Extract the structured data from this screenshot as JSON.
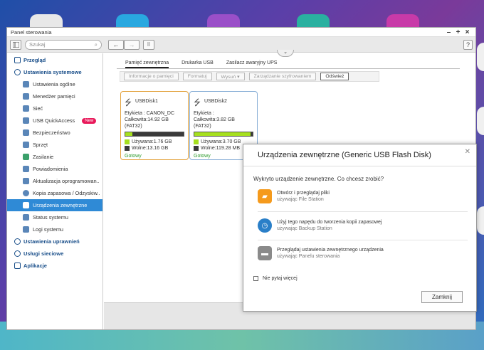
{
  "window": {
    "title": "Panel sterowania",
    "controls": [
      "–",
      "+",
      "×"
    ]
  },
  "toolbar": {
    "search_placeholder": "Szukaj",
    "back_icon": "arrow-left-icon",
    "forward_icon": "arrow-right-icon",
    "help_label": "?"
  },
  "sidebar": {
    "overview": "Przegląd",
    "system_settings": "Ustawienia systemowe",
    "items": [
      {
        "label": "Ustawienia ogólne"
      },
      {
        "label": "Menedżer pamięci"
      },
      {
        "label": "Sieć"
      },
      {
        "label": "USB QuickAccess",
        "badge": "New"
      },
      {
        "label": "Bezpieczeństwo"
      },
      {
        "label": "Sprzęt"
      },
      {
        "label": "Zasilanie"
      },
      {
        "label": "Powiadomienia"
      },
      {
        "label": "Aktualizacja oprogramowan.."
      },
      {
        "label": "Kopia zapasowa / Odzyskiw.."
      },
      {
        "label": "Urządzenia zewnętrzne"
      },
      {
        "label": "Status systemu"
      },
      {
        "label": "Logi systemu"
      }
    ],
    "privileges": "Ustawienia uprawnień",
    "network_services": "Usługi sieciowe",
    "apps": "Aplikacje"
  },
  "tabs": [
    "Pamięć zewnętrzna",
    "Drukarka USB",
    "Zasilacz awaryjny UPS"
  ],
  "actions": {
    "info": "Informacje o pamięci",
    "format": "Formatuj",
    "eject": "Wysuń ▾",
    "encryption": "Zarządzanie szyfrowaniem",
    "refresh": "Odśwież"
  },
  "disks": [
    {
      "name": "USBDisk1",
      "label_line": "Etykieta : CANON_DC",
      "total_line": "Całkowita:14.92 GB (FAT32)",
      "used_line": "Używana:1.76 GB",
      "free_line": "Wolne:13.16 GB",
      "used_fraction": 0.118,
      "status": "Gotowy"
    },
    {
      "name": "USBDisk2",
      "label_line": "Etykieta :",
      "total_line": "Całkowita:3.82 GB (FAT32)",
      "used_line": "Używana:3.70 GB",
      "free_line": "Wolne:119.28 MB",
      "used_fraction": 0.969,
      "status": "Gotowy"
    }
  ],
  "dialog": {
    "title": "Urządzenia zewnętrzne (Generic USB Flash Disk)",
    "question": "Wykryto urządzenie zewnętrzne. Co chcesz zrobić?",
    "options": [
      {
        "title": "Otwórz i przeglądaj pliki",
        "subtitle": "używając File Station",
        "icon": "folder-icon"
      },
      {
        "title": "Użyj tego napędu do tworzenia kopii zapasowej",
        "subtitle": "używając Backup Station",
        "icon": "backup-clock-icon"
      },
      {
        "title": "Przeglądaj ustawienia zewnętrznego urządzenia",
        "subtitle": "używając Panelu sterowania",
        "icon": "drive-icon"
      }
    ],
    "checkbox_label": "Nie pytaj więcej",
    "close_button": "Zamknij"
  },
  "colors": {
    "accent": "#2f8ad6",
    "used_bar": "#a6e01e",
    "free_bar": "#3a3a3a",
    "ready_text": "#2a9a2a",
    "badge": "#e8195a"
  }
}
